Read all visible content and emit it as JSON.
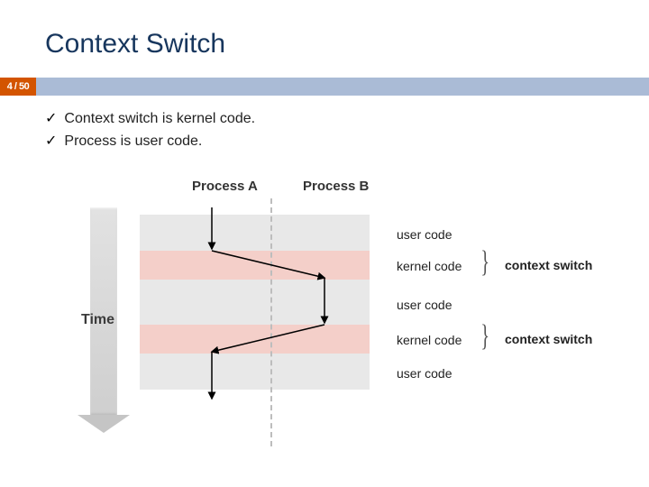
{
  "title": "Context Switch",
  "page_indicator": "4 / 50",
  "accent_color": "#d35400",
  "header_band_color": "#aabbd6",
  "bullets": [
    "Context switch is kernel code.",
    "Process is user code."
  ],
  "check_glyph": "✓",
  "diagram": {
    "time_axis_label": "Time",
    "process_a_header": "Process A",
    "process_b_header": "Process B",
    "right_labels": {
      "user_code": "user code",
      "kernel_code": "kernel code"
    },
    "context_switch_label": "context switch"
  }
}
